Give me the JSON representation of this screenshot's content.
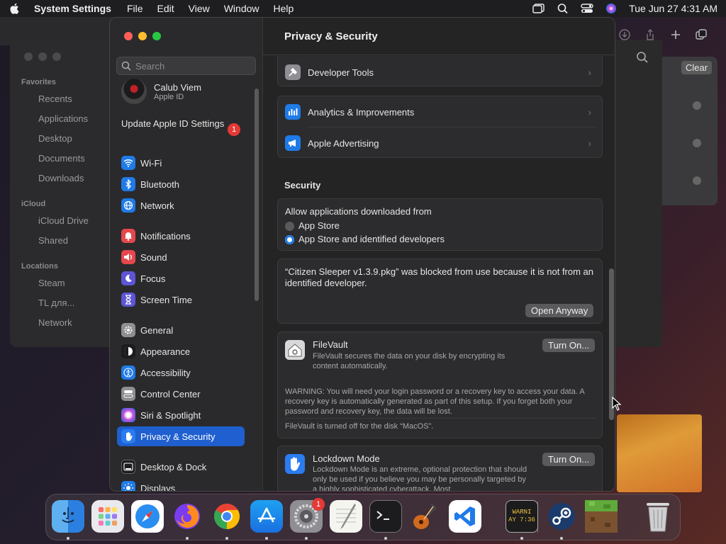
{
  "menubar": {
    "app_name": "System Settings",
    "items": [
      "File",
      "Edit",
      "View",
      "Window",
      "Help"
    ],
    "datetime": "Tue Jun 27  4:31 AM"
  },
  "finder": {
    "clear_label": "Clear",
    "sidebar": {
      "favorites_heading": "Favorites",
      "favorites": [
        "Recents",
        "Applications",
        "Desktop",
        "Documents",
        "Downloads"
      ],
      "icloud_heading": "iCloud",
      "icloud": [
        "iCloud Drive",
        "Shared"
      ],
      "locations_heading": "Locations",
      "locations": [
        "Steam",
        "TL для...",
        "Network"
      ]
    }
  },
  "settings": {
    "search_placeholder": "Search",
    "account": {
      "name": "Calub Viem",
      "subtitle": "Apple ID"
    },
    "update": {
      "label": "Update Apple ID Settings",
      "badge": "1"
    },
    "nav": [
      {
        "label": "Wi-Fi",
        "color": "#1f7be8"
      },
      {
        "label": "Bluetooth",
        "color": "#1f7be8"
      },
      {
        "label": "Network",
        "color": "#1f7be8"
      },
      {
        "label": "Notifications",
        "color": "#e5474d"
      },
      {
        "label": "Sound",
        "color": "#e5474d"
      },
      {
        "label": "Focus",
        "color": "#5e55d6"
      },
      {
        "label": "Screen Time",
        "color": "#5e55d6"
      },
      {
        "label": "General",
        "color": "#8e8e93"
      },
      {
        "label": "Appearance",
        "color": "#1c1c1e"
      },
      {
        "label": "Accessibility",
        "color": "#1f7be8"
      },
      {
        "label": "Control Center",
        "color": "#8e8e93"
      },
      {
        "label": "Siri & Spotlight",
        "color": "#b03fd6"
      },
      {
        "label": "Privacy & Security",
        "color": "#1f7be8"
      },
      {
        "label": "Desktop & Dock",
        "color": "#1c1c1e"
      },
      {
        "label": "Displays",
        "color": "#1f7be8"
      }
    ],
    "active_nav": "Privacy & Security",
    "title": "Privacy & Security",
    "privacy_rows": [
      "Developer Tools",
      "Analytics & Improvements",
      "Apple Advertising"
    ],
    "security_heading": "Security",
    "allow": {
      "label": "Allow applications downloaded from",
      "options": [
        "App Store",
        "App Store and identified developers"
      ],
      "selected": "App Store and identified developers"
    },
    "blocked": {
      "message": "“Citizen Sleeper v1.3.9.pkg” was blocked from use because it is not from an identified developer.",
      "button": "Open Anyway"
    },
    "filevault": {
      "title": "FileVault",
      "description": "FileVault secures the data on your disk by encrypting its content automatically.",
      "button": "Turn On...",
      "warning": "WARNING: You will need your login password or a recovery key to access your data. A recovery key is automatically generated as part of this setup. If you forget both your password and recovery key, the data will be lost.",
      "status": "FileVault is turned off for the disk “MacOS”."
    },
    "lockdown": {
      "title": "Lockdown Mode",
      "description": "Lockdown Mode is an extreme, optional protection that should only be used if you believe you may be personally targeted by a highly sophisticated cyberattack. Most",
      "button": "Turn On..."
    }
  },
  "dock": {
    "apps": [
      "Finder",
      "Launchpad",
      "Safari",
      "Firefox",
      "Chrome",
      "App Store",
      "System Settings",
      "TextEdit",
      "Terminal",
      "GarageBand",
      "Visual Studio Code",
      "Console",
      "Steam",
      "Minecraft",
      "Trash"
    ],
    "settings_badge": "1",
    "console_text": "WARNI\nAY 7:36"
  }
}
